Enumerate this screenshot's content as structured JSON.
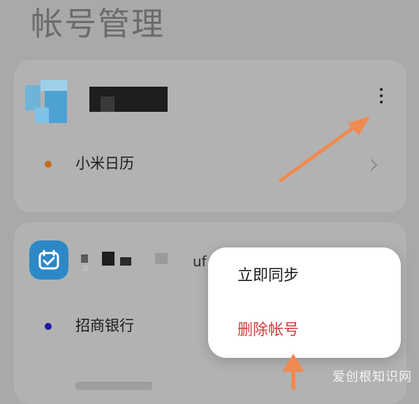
{
  "header": {
    "title": "帐号管理"
  },
  "accounts": [
    {
      "name_redacted": true,
      "more_icon": "more-vertical-icon",
      "items": [
        {
          "label": "小米日历",
          "dot_color": "#c36b1a"
        }
      ]
    },
    {
      "name_fragment": "uf",
      "items": [
        {
          "label": "招商银行",
          "dot_color": "#1a1aa6"
        }
      ]
    }
  ],
  "popup_menu": {
    "items": [
      {
        "label": "立即同步"
      },
      {
        "label": "删除帐号",
        "color": "#d53b3b"
      }
    ]
  },
  "colors": {
    "annotation_arrow": "#f08a50",
    "delete_red": "#d53b3b"
  },
  "watermark": "爱创根知识网"
}
